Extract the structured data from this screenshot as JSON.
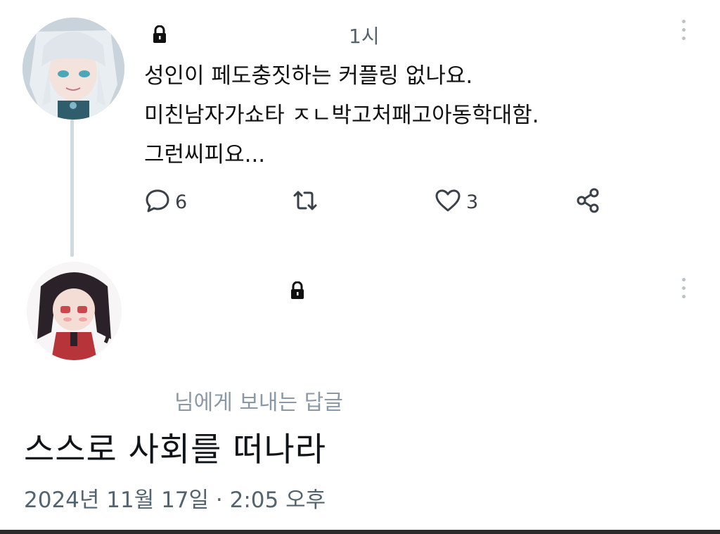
{
  "tweet": {
    "time": "1시",
    "lines": [
      "성인이 페도충짓하는 커플링 없나요.",
      "미친남자가쇼타 ㅈㄴ박고처패고아동학대함.",
      "그런씨피요..."
    ],
    "reply_count": "6",
    "like_count": "3"
  },
  "reply": {
    "replying_to": "님에게 보내는 답글",
    "text": "스스로 사회를 떠나라",
    "timestamp": "2024년 11월 17일 · 2:05 오후"
  },
  "icons": {
    "lock": "lock-icon",
    "more": "more-vertical-icon",
    "reply": "comment-icon",
    "retweet": "retweet-icon",
    "like": "heart-icon",
    "share": "share-icon"
  },
  "colors": {
    "thread_line": "#cfd9de",
    "muted_text": "#536471",
    "icon": "#3a4148"
  }
}
